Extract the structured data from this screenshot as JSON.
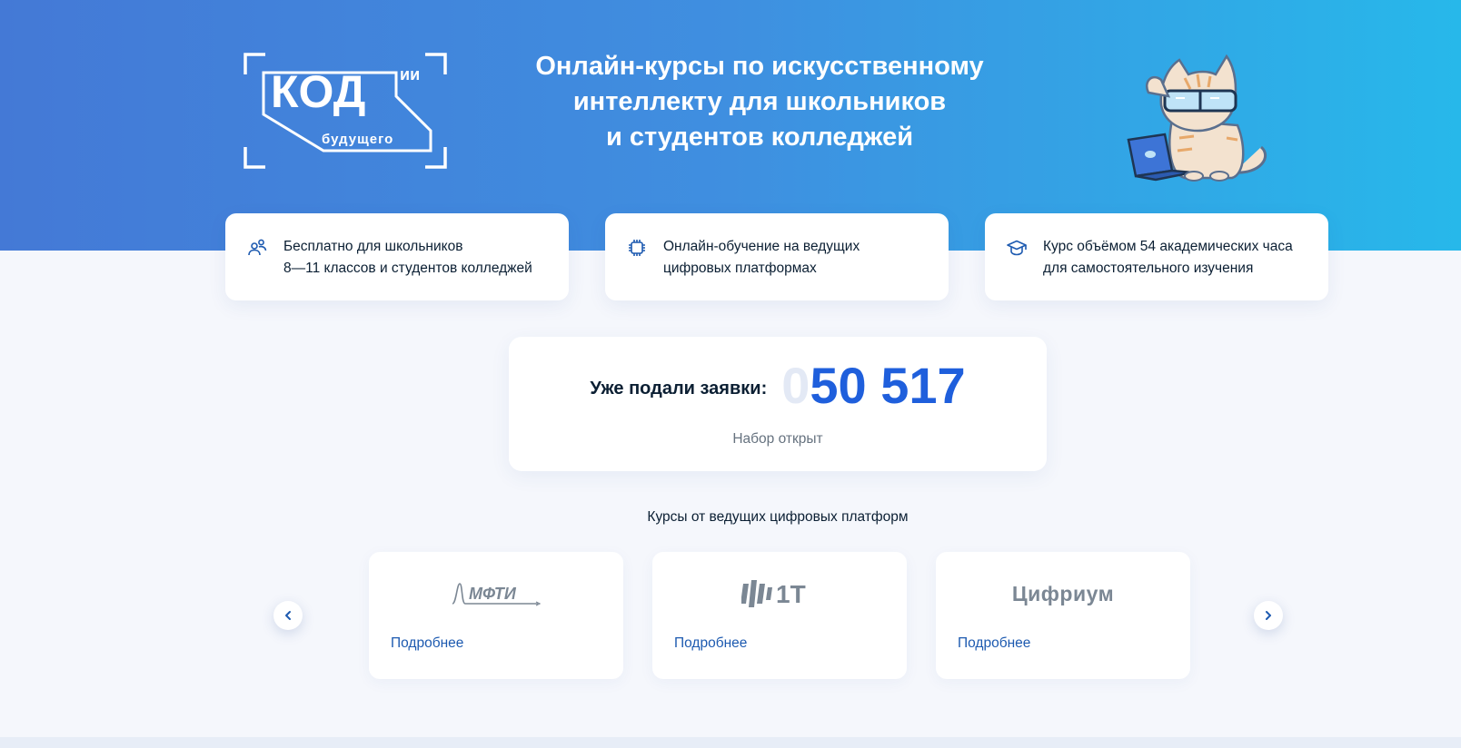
{
  "hero": {
    "logo": {
      "main_text": "КОД",
      "sub_text": "будущего",
      "tag_text": "ии"
    },
    "title_lines": [
      "Онлайн-курсы по искусственному",
      "интеллекту для школьников",
      "и студентов колледжей"
    ]
  },
  "features": [
    {
      "icon": "users-icon",
      "lines": [
        "Бесплатно для школьников",
        "8—11 классов и студентов колледжей"
      ]
    },
    {
      "icon": "chip-icon",
      "lines": [
        "Онлайн-обучение на ведущих",
        "цифровых платформах"
      ]
    },
    {
      "icon": "graduation-cap-icon",
      "lines": [
        "Курс объёмом 54 академических часа",
        "для самостоятельного изучения"
      ]
    }
  ],
  "counter": {
    "label": "Уже подали заявки:",
    "leading_digit": "0",
    "value": "50 517",
    "status": "Набор открыт"
  },
  "platforms": {
    "title": "Курсы от ведущих цифровых платформ",
    "items": [
      {
        "logo_text": "МФТИ",
        "link": "Подробнее"
      },
      {
        "logo_text": "1Т",
        "link": "Подробнее"
      },
      {
        "logo_text": "Цифриум",
        "link": "Подробнее"
      }
    ]
  },
  "colors": {
    "hero_gradient_start": "#4479d6",
    "hero_gradient_end": "#27b8ea",
    "counter_value": "#1f5fdc",
    "link": "#1d5ab0",
    "logo_gray": "#7b8794"
  }
}
